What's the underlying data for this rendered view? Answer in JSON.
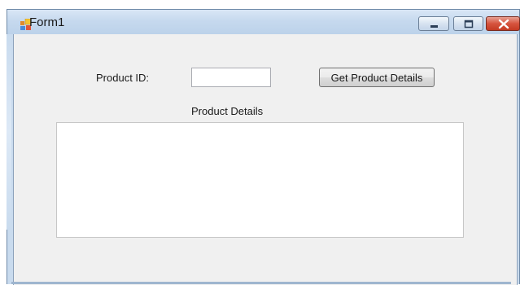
{
  "window": {
    "title": "Form1",
    "icon": "windows-form-icon",
    "caption_buttons": [
      "minimize-icon",
      "maximize-icon",
      "close-icon"
    ],
    "colors": {
      "title_bar": "#c9dbee",
      "client_background": "#f0f0f0",
      "close_button": "#c43a23"
    }
  },
  "form": {
    "product_id_label": "Product ID:",
    "product_id_value": "",
    "get_details_label": "Get Product Details",
    "product_details_label": "Product Details",
    "product_details_value": ""
  }
}
